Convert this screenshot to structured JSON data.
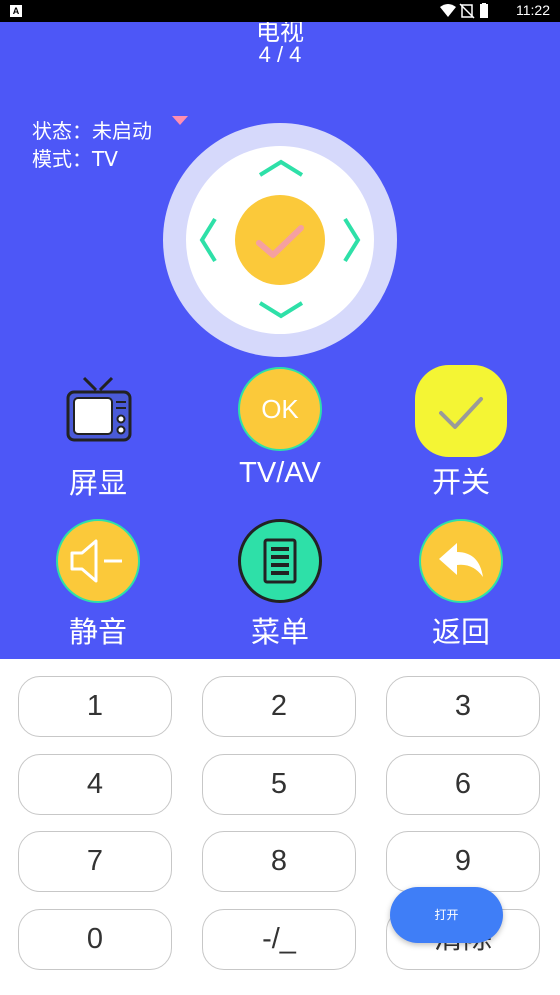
{
  "status_bar": {
    "time": "11:22",
    "app_icon_letter": "A",
    "battery_icon": "battery-icon",
    "wifi_icon": "wifi-icon"
  },
  "header": {
    "title": "电视",
    "page": "4 / 4"
  },
  "device_status": {
    "state": "状态：未启动",
    "mode": "模式：TV"
  },
  "colors": {
    "remote_bg": "#4d57f7",
    "accent_yellow": "#fbc93a",
    "arrow_green": "#2ee0a8",
    "power_yellow": "#f4f534"
  },
  "buttons": {
    "screen_display": "屏显",
    "tv_av": "TV/AV",
    "ok": "OK",
    "power": "开关",
    "mute": "静音",
    "menu": "菜单",
    "back": "返回"
  },
  "keypad": {
    "keys": [
      "1",
      "2",
      "3",
      "4",
      "5",
      "6",
      "7",
      "8",
      "9",
      "0",
      "-/_",
      "清除"
    ]
  },
  "fab": {
    "label": "打开"
  }
}
